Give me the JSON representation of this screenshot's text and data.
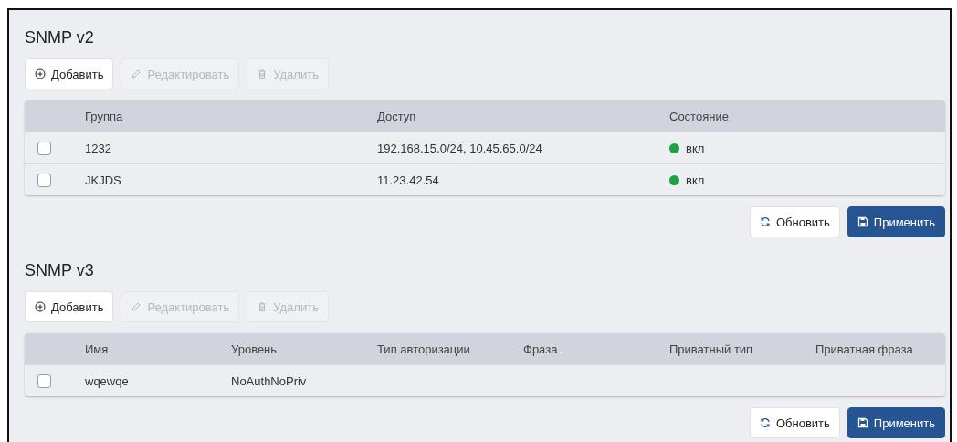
{
  "sections": [
    {
      "title": "SNMP v2",
      "toolbar": [
        {
          "kind": "add",
          "label": "Добавить",
          "disabled": false
        },
        {
          "kind": "edit",
          "label": "Редактировать",
          "disabled": true
        },
        {
          "kind": "delete",
          "label": "Удалить",
          "disabled": true
        }
      ],
      "table": {
        "columns": [
          "Группа",
          "Доступ",
          "Состояние"
        ],
        "rows": [
          {
            "checked": false,
            "cells": [
              {
                "kind": "text",
                "text": "1232"
              },
              {
                "kind": "text",
                "text": "192.168.15.0/24, 10.45.65.0/24"
              },
              {
                "kind": "status",
                "text": "вкл",
                "color": "#1fa14a"
              }
            ]
          },
          {
            "checked": false,
            "cells": [
              {
                "kind": "text",
                "text": "JKJDS"
              },
              {
                "kind": "text",
                "text": "11.23.42.54"
              },
              {
                "kind": "status",
                "text": "вкл",
                "color": "#1fa14a"
              }
            ]
          }
        ]
      },
      "actions": [
        {
          "kind": "refresh",
          "label": "Обновить"
        },
        {
          "kind": "apply",
          "label": "Применить"
        }
      ]
    },
    {
      "title": "SNMP v3",
      "toolbar": [
        {
          "kind": "add",
          "label": "Добавить",
          "disabled": false
        },
        {
          "kind": "edit",
          "label": "Редактировать",
          "disabled": true
        },
        {
          "kind": "delete",
          "label": "Удалить",
          "disabled": true
        }
      ],
      "table": {
        "columns": [
          "Имя",
          "Уровень",
          "Тип авторизации",
          "Фраза",
          "Приватный тип",
          "Приватная фраза"
        ],
        "rows": [
          {
            "checked": false,
            "cells": [
              {
                "kind": "text",
                "text": "wqewqe"
              },
              {
                "kind": "text",
                "text": "NoAuthNoPriv"
              }
            ]
          }
        ]
      },
      "actions": [
        {
          "kind": "refresh",
          "label": "Обновить"
        },
        {
          "kind": "apply",
          "label": "Применить"
        }
      ]
    }
  ]
}
